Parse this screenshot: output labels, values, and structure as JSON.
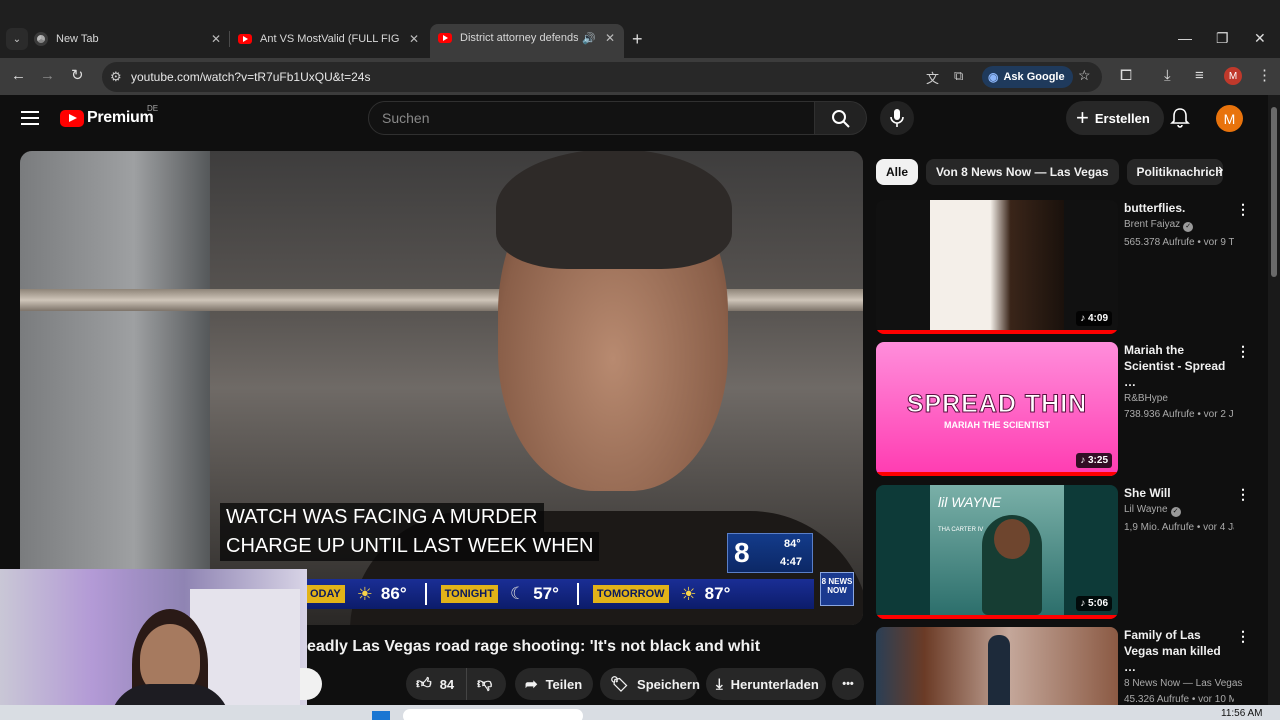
{
  "browser": {
    "tabs": [
      {
        "title": "New Tab",
        "icon": "chrome-icon"
      },
      {
        "title": "Ant VS MostValid (FULL FIGHT)",
        "icon": "youtube-icon"
      },
      {
        "title": "District attorney defends pl",
        "icon": "youtube-icon",
        "active": true,
        "audio": "🔊"
      }
    ],
    "close_glyph": "✕",
    "new_tab": "+",
    "window_controls": {
      "minimize": "—",
      "maximize": "❐",
      "close": "✕"
    },
    "url": "youtube.com/watch?v=tR7uFb1UxQU&t=24s",
    "ask_google": "Ask Google",
    "profile_initial": "M"
  },
  "youtube": {
    "logo_text": "Premium",
    "logo_region": "DE",
    "search_placeholder": "Suchen",
    "create_label": "Erstellen",
    "avatar_initial": "M"
  },
  "video": {
    "caption_lines": [
      "WATCH WAS FACING A MURDER",
      "CHARGE UP UNTIL LAST WEEK WHEN"
    ],
    "station_logo": "8",
    "station_temp": "84°",
    "station_time": "4:47",
    "weather": [
      {
        "label": "ODAY",
        "icon": "sun-icon",
        "temp": "86°"
      },
      {
        "label": "TONIGHT",
        "icon": "moon-icon",
        "temp": "57°"
      },
      {
        "label": "TOMORROW",
        "icon": "sun-icon",
        "temp": "87°"
      }
    ],
    "corner_logo": "8 NEWS NOW",
    "title": "eadly Las Vegas road rage shooting: 'It's not black and whit"
  },
  "actions": {
    "likes": "84",
    "share": "Teilen",
    "save": "Speichern",
    "download": "Herunterladen",
    "more": "•••"
  },
  "chips": [
    "Alle",
    "Von 8 News Now — Las Vegas",
    "Politiknachricht"
  ],
  "recommendations": [
    {
      "title": "butterflies.",
      "channel": "Brent Faiyaz",
      "verified": true,
      "meta": "565.378 Aufrufe • vor 9 T…",
      "duration": "4:09",
      "thumb_colors": [
        "#f4efe9",
        "#3a2519"
      ]
    },
    {
      "title": "Mariah the Scientist - Spread …",
      "channel": "R&BHype",
      "verified": false,
      "meta": "738.936 Aufrufe • vor 2 J…",
      "duration": "3:25",
      "thumb_text": "SPREAD THIN",
      "thumb_sub": "MARIAH THE SCIENTIST",
      "thumb_colors": [
        "#ff7fd6",
        "#ff3bb1"
      ]
    },
    {
      "title": "She Will",
      "channel": "Lil Wayne",
      "verified": true,
      "meta": "1,9 Mio. Aufrufe • vor 4 Ja…",
      "duration": "5:06",
      "thumb_text": "lil WAYNE",
      "thumb_sub": "THA CARTER IV",
      "thumb_colors": [
        "#2a6d6a",
        "#7ab0a8"
      ]
    },
    {
      "title": "Family of Las Vegas man killed …",
      "channel": "8 News Now — Las Vegas",
      "verified": false,
      "meta": "45.326 Aufrufe • vor 10 M…",
      "duration": "",
      "thumb_colors": [
        "#6b3b26",
        "#c4a79a"
      ]
    }
  ],
  "taskbar": {
    "clock": "11:56 AM"
  }
}
